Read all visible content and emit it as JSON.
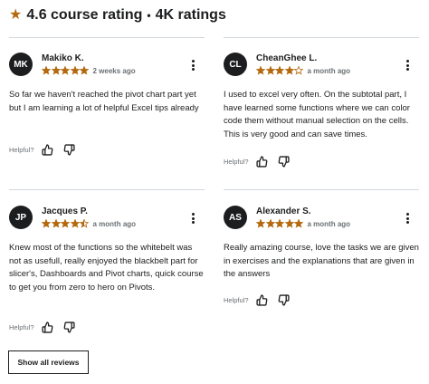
{
  "header": {
    "rating_text": "4.6 course rating",
    "separator": "•",
    "ratings_count_text": "4K ratings",
    "icon": "star-icon",
    "star_color": "#b4690e"
  },
  "reviews": [
    {
      "initials": "MK",
      "name": "Makiko K.",
      "rating": 5,
      "time": "2 weeks ago",
      "text": "So far we haven't reached the pivot chart part yet but I am learning a lot of helpful Excel tips already",
      "helpful_label": "Helpful?"
    },
    {
      "initials": "CL",
      "name": "CheanGhee L.",
      "rating": 4,
      "time": "a month ago",
      "text": "I used to excel very often. On the subtotal part, I have learned some functions where we can color code them without manual selection on the cells. This is very good and can save times.",
      "helpful_label": "Helpful?"
    },
    {
      "initials": "JP",
      "name": "Jacques P.",
      "rating": 4.5,
      "time": "a month ago",
      "text": "Knew most of the functions so the whitebelt was not as usefull, really enjoyed the blackbelt part for slicer's, Dashboards and Pivot charts, quick course to get you from zero to hero on Pivots.",
      "helpful_label": "Helpful?"
    },
    {
      "initials": "AS",
      "name": "Alexander S.",
      "rating": 5,
      "time": "a month ago",
      "text": "Really amazing course, love the tasks we are given in exercises and the explanations that are given in the answers",
      "helpful_label": "Helpful?"
    }
  ],
  "show_all_label": "Show all reviews",
  "colors": {
    "text": "#1c1d1f",
    "muted": "#6a6f73",
    "star": "#b4690e",
    "divider": "#d1d7dc",
    "avatar_bg": "#1c1d1f"
  }
}
